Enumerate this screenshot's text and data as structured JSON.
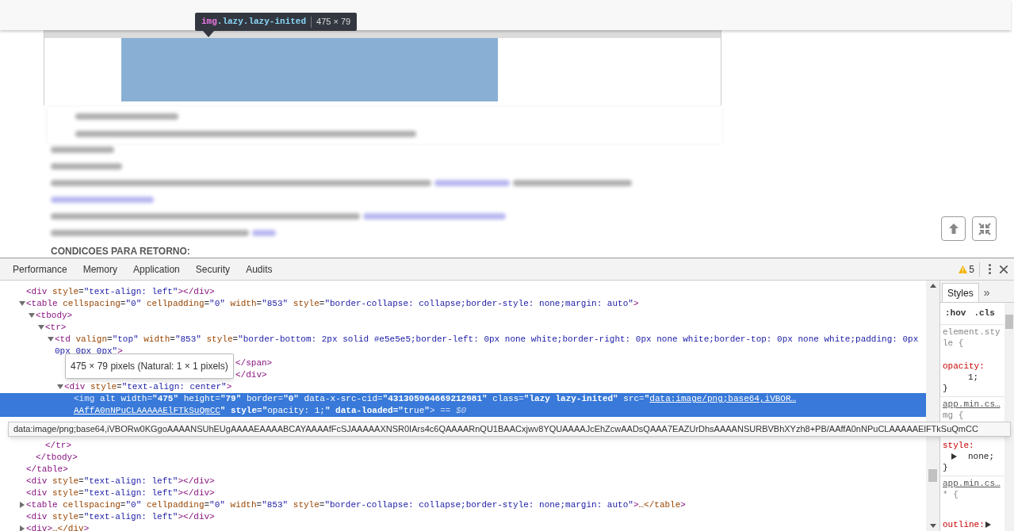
{
  "page": {
    "highlight_tooltip": {
      "selector_tag": "img",
      "selector_classes": ".lazy.lazy-inited",
      "size": "475 × 79"
    },
    "heading": "CONDICOES PARA RETORNO:"
  },
  "devtools": {
    "tabs": [
      {
        "label": "Performance",
        "selected": false
      },
      {
        "label": "Memory",
        "selected": false
      },
      {
        "label": "Application",
        "selected": false
      },
      {
        "label": "Security",
        "selected": false
      },
      {
        "label": "Audits",
        "selected": false
      }
    ],
    "warnings": "5",
    "elements": {
      "nodes": [
        {
          "text": "<div style=\"text-align: left\"></div>"
        },
        {
          "text": "<table cellspacing=\"0\" cellpadding=\"0\" width=\"853\" style=\"border-collapse: collapse;border-style: none;margin: auto\">",
          "expanded": true,
          "close": "</table>",
          "children": [
            {
              "text": "<tbody>",
              "expanded": true,
              "close": "</tbody>",
              "children": [
                {
                  "text": "<tr>",
                  "expanded": true,
                  "close": "</tr>",
                  "children": [
                    {
                      "text": "<td valign=\"top\" width=\"853\" style=\"border-bottom: 2px solid #e5e5e5;border-left: 0px none white;border-right: 0px none white;border-top: 0px none white;padding: 0px 0px 0px 0px\">",
                      "expanded": true,
                      "children": [
                        {
                          "kind": "tail",
                          "text": "</span>"
                        },
                        {
                          "kind": "tail",
                          "text": "</div>"
                        },
                        {
                          "text": "<div style=\"text-align: center\">",
                          "expanded": true,
                          "children": [
                            {
                              "kind": "selected",
                              "selected": true,
                              "text": "<img alt width=\"475\" height=\"79\" border=\"0\" data-x-src-cid=\"431305964669212981\" class=\"lazy lazy-inited\" src=\"",
                              "link": [
                                "data:image/png;base64,iVBOR…",
                                "AAffA0nNPuCLAAAAAElFTkSuQmCC"
                              ],
                              "rest": "\" style=\"opacity: 1;\" data-loaded=\"true\">",
                              "suffix": "== $0",
                              "hover_tooltip": "475 × 79 pixels (Natural: 1 × 1 pixels)",
                              "src_tooltip": "data:image/png;base64,iVBORw0KGgoAAAANSUhEUgAAAAEAAAABCAYAAAAfFcSJAAAAAXNSR0IArs4c6QAAAARnQU1BAACxjwv8YQUAAAAJcEhZcwAADsQAAA7EAZUrDhsAAAANSURBVBhXYzh8+PB/AAffA0nNPuCLAAAAAElFTkSuQmCC"
                            }
                          ]
                        }
                      ]
                    }
                  ]
                }
              ]
            }
          ]
        },
        {
          "text": "<div style=\"text-align: left\"></div>"
        },
        {
          "text": "<div style=\"text-align: left\"></div>"
        },
        {
          "text": "<table cellspacing=\"0\" cellpadding=\"0\" width=\"853\" style=\"border-collapse: collapse;border-style: none;margin: auto\">…</table>",
          "expanded": false
        },
        {
          "text": "<div style=\"text-align: left\"></div>"
        },
        {
          "text": "<div>…</div>",
          "expanded": false
        }
      ]
    },
    "styles": {
      "tabs": [
        {
          "label": "Styles",
          "selected": true
        }
      ],
      "more": "»",
      "filters": [
        ":hov",
        ".cls"
      ],
      "rules": [
        {
          "selector": "element.style {",
          "props": [
            {
              "name": "opacity:",
              "value": "1;"
            }
          ],
          "close": "}"
        },
        {
          "source": "app.min.cs…",
          "selector": "mg {",
          "props": [
            {
              "name": "style:",
              "value": "none;",
              "expandable": true
            }
          ],
          "close": "}"
        },
        {
          "source": "app.min.cs…",
          "selector": "* {",
          "props": [
            {
              "name": "outline:",
              "expandable": true
            }
          ]
        }
      ]
    }
  }
}
